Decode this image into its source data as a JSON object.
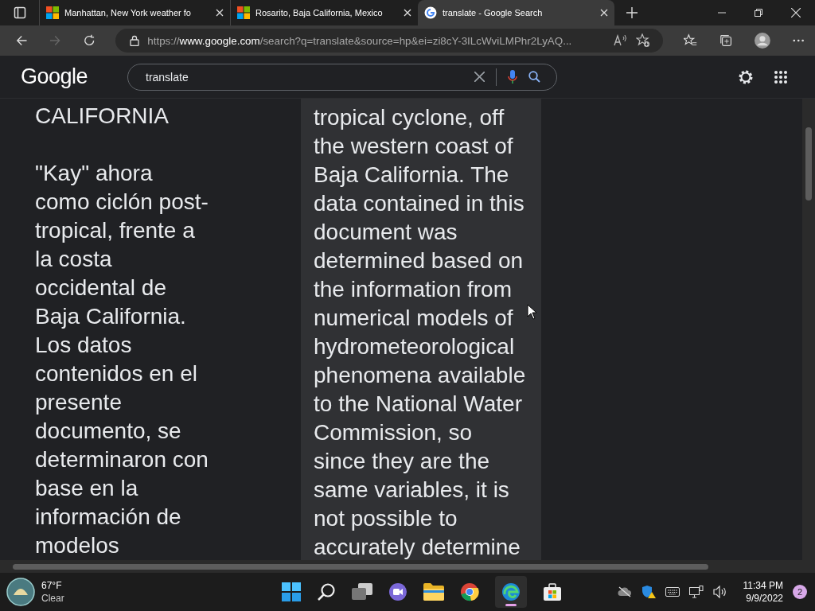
{
  "tabs": [
    {
      "title": "Manhattan, New York weather fo",
      "kind": "windows",
      "selected": false
    },
    {
      "title": "Rosarito, Baja California, Mexico",
      "kind": "windows",
      "selected": false
    },
    {
      "title": "translate - Google Search",
      "kind": "google",
      "selected": true
    }
  ],
  "address_bar": {
    "url_prefix": "https://",
    "url_domain": "www.google.com",
    "url_rest": "/search?q=translate&source=hp&ei=zi8cY-3ILcWviLMPhr2LyAQ..."
  },
  "google_header": {
    "logo": "Google",
    "search_value": "translate"
  },
  "left_column": {
    "heading": "CALIFORNIA",
    "lines": [
      "\"Kay\" ahora",
      "como ciclón post-",
      "tropical, frente a",
      "la costa",
      "occidental de",
      "Baja California.",
      "Los datos",
      "contenidos en el",
      "presente",
      "documento, se",
      "determinaron con",
      "base en la",
      "información de",
      "modelos"
    ]
  },
  "right_column": {
    "lines": [
      "tropical cyclone, off",
      "the western coast of",
      "Baja California. The",
      "data contained in this",
      "document was",
      "determined based on",
      "the information from",
      "numerical models of",
      "hydrometeorological",
      "phenomena available",
      "to the National Water",
      "Commission, so",
      "since they are the",
      "same variables, it is",
      "not possible to",
      "accurately determine"
    ]
  },
  "taskbar": {
    "temperature": "67°F",
    "condition": "Clear",
    "time": "11:34 PM",
    "date": "9/9/2022",
    "notification_count": "2"
  }
}
